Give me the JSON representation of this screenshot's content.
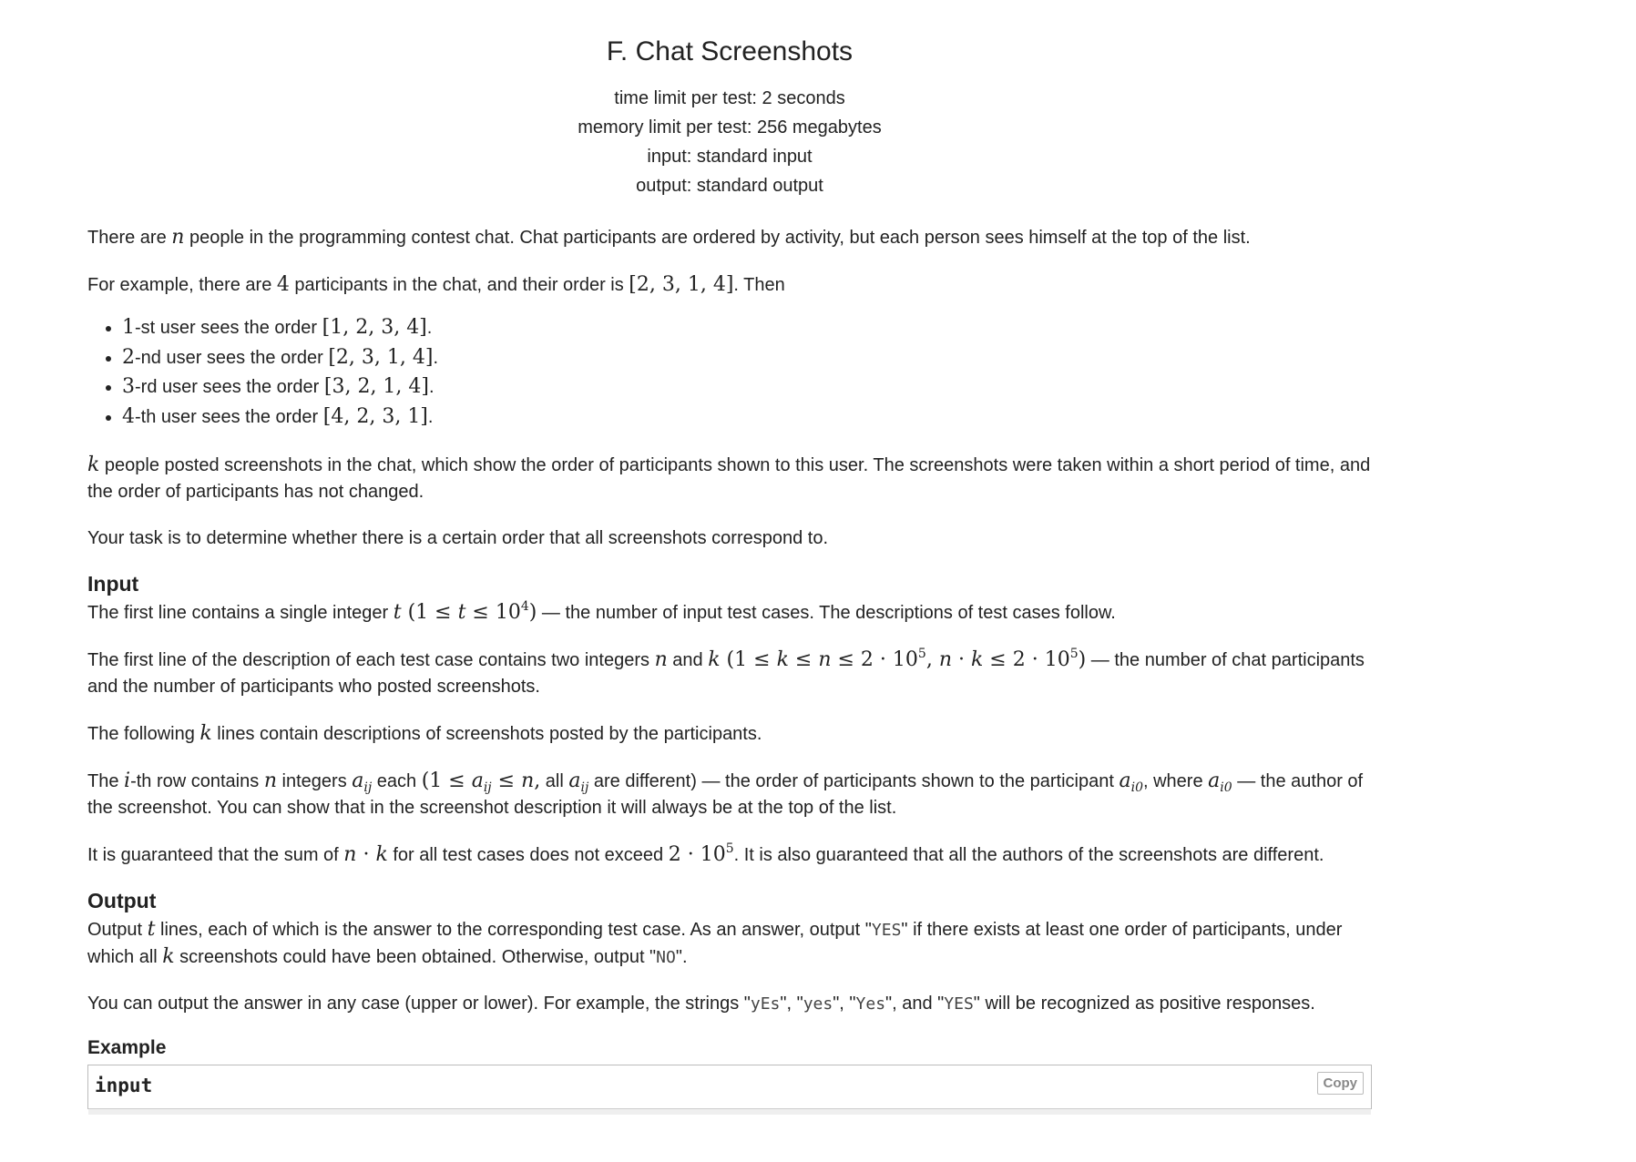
{
  "header": {
    "title": "F. Chat Screenshots",
    "time_limit": "time limit per test: 2 seconds",
    "memory_limit": "memory limit per test: 256 megabytes",
    "input": "input: standard input",
    "output": "output: standard output"
  },
  "statement": {
    "p1_a": "There are ",
    "p1_n": "n",
    "p1_b": " people in the programming contest chat. Chat participants are ordered by activity, but each person sees himself at the top of the list.",
    "p2_a": "For example, there are ",
    "p2_num": "4",
    "p2_b": " participants in the chat, and their order is ",
    "p2_order": "[2, 3, 1, 4]",
    "p2_c": ". Then",
    "bullets": [
      {
        "num": "1",
        "suffix": "-st user sees the order ",
        "order": "[1, 2, 3, 4]",
        "end": "."
      },
      {
        "num": "2",
        "suffix": "-nd user sees the order ",
        "order": "[2, 3, 1, 4]",
        "end": "."
      },
      {
        "num": "3",
        "suffix": "-rd user sees the order ",
        "order": "[3, 2, 1, 4]",
        "end": "."
      },
      {
        "num": "4",
        "suffix": "-th user sees the order ",
        "order": "[4, 2, 3, 1]",
        "end": "."
      }
    ],
    "p3_k": "k",
    "p3_b": " people posted screenshots in the chat, which show the order of participants shown to this user. The screenshots were taken within a short period of time, and the order of participants has not changed.",
    "p4": "Your task is to determine whether there is a certain order that all screenshots correspond to."
  },
  "input_section": {
    "heading": "Input",
    "l1_a": "The first line contains a single integer ",
    "l1_t": "t",
    "l1_range_a": " (1 ≤ ",
    "l1_range_t": "t",
    "l1_range_b": " ≤ 10",
    "l1_exp": "4",
    "l1_range_c": ")",
    "l1_b": " — the number of input test cases. The descriptions of test cases follow.",
    "l2_a": "The first line of the description of each test case contains two integers ",
    "l2_n": "n",
    "l2_and": " and ",
    "l2_k": "k",
    "l2_r1": " (1 ≤ ",
    "l2_r_k": "k",
    "l2_r2": " ≤ ",
    "l2_r_n": "n",
    "l2_r3": " ≤ 2 · 10",
    "l2_exp1": "5",
    "l2_r4": ", ",
    "l2_r_n2": "n",
    "l2_r5": " · ",
    "l2_r_k2": "k",
    "l2_r6": " ≤ 2 · 10",
    "l2_exp2": "5",
    "l2_r7": ")",
    "l2_b": " — the number of chat participants and the number of participants who posted screenshots.",
    "l3_a": "The following ",
    "l3_k": "k",
    "l3_b": " lines contain descriptions of screenshots posted by the participants.",
    "l4_a": "The ",
    "l4_i": "i",
    "l4_b": "-th row contains ",
    "l4_n": "n",
    "l4_c": " integers ",
    "l4_a1": "a",
    "l4_a1_sub": "ij",
    "l4_d": " each ",
    "l4_r1": "(1 ≤ ",
    "l4_r_a": "a",
    "l4_r_sub": "ij",
    "l4_r2": " ≤ ",
    "l4_r_n": "n",
    "l4_r3": ",",
    "l4_e": " all ",
    "l4_a2": "a",
    "l4_a2_sub": "ij",
    "l4_f": " are different) — the order of participants shown to the participant ",
    "l4_a3": "a",
    "l4_a3_sub": "i0",
    "l4_g": ", where ",
    "l4_a4": "a",
    "l4_a4_sub": "i0",
    "l4_h": " — the author of the screenshot. You can show that in the screenshot description it will always be at the top of the list.",
    "l5_a": "It is guaranteed that the sum of ",
    "l5_n": "n",
    "l5_dot": " · ",
    "l5_k": "k",
    "l5_b": " for all test cases does not exceed ",
    "l5_num": "2 · 10",
    "l5_exp": "5",
    "l5_c": ". It is also guaranteed that all the authors of the screenshots are different."
  },
  "output_section": {
    "heading": "Output",
    "l1_a": "Output ",
    "l1_t": "t",
    "l1_b": " lines, each of which is the answer to the corresponding test case. As an answer, output \"",
    "l1_yes": "YES",
    "l1_c": "\" if there exists at least one order of participants, under which all ",
    "l1_k": "k",
    "l1_d": " screenshots could have been obtained. Otherwise, output \"",
    "l1_no": "NO",
    "l1_e": "\".",
    "l2_a": "You can output the answer in any case (upper or lower). For example, the strings \"",
    "l2_s1": "yEs",
    "l2_sep1": "\", \"",
    "l2_s2": "yes",
    "l2_sep2": "\", \"",
    "l2_s3": "Yes",
    "l2_sep3": "\", and \"",
    "l2_s4": "YES",
    "l2_b": "\" will be recognized as positive responses."
  },
  "example": {
    "heading": "Example",
    "input_label": "input",
    "copy_label": "Copy"
  }
}
